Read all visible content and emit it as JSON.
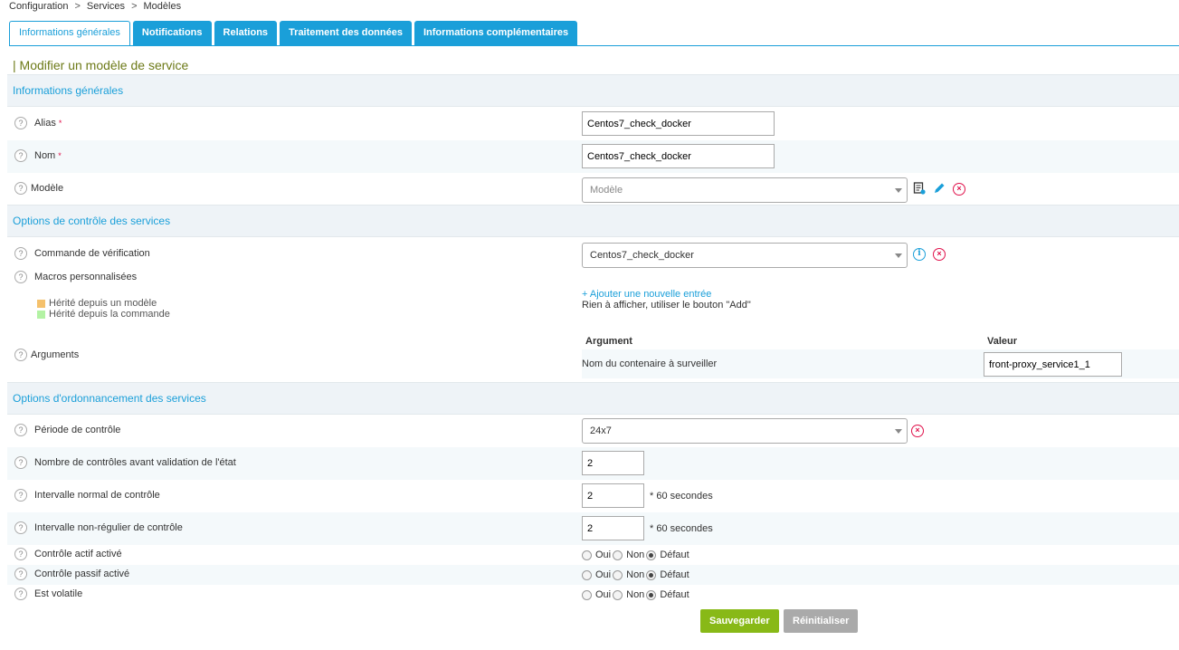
{
  "breadcrumb": [
    "Configuration",
    "Services",
    "Modèles"
  ],
  "tabs": [
    "Informations générales",
    "Notifications",
    "Relations",
    "Traitement des données",
    "Informations complémentaires"
  ],
  "page_title": "| Modifier un modèle de service",
  "sections": {
    "general": "Informations générales",
    "control": "Options de contrôle des services",
    "scheduling": "Options d'ordonnancement des services"
  },
  "fields": {
    "alias": {
      "label": "Alias",
      "value": "Centos7_check_docker",
      "required": "*"
    },
    "nom": {
      "label": "Nom",
      "value": "Centos7_check_docker",
      "required": "*"
    },
    "modele": {
      "label": "Modèle",
      "placeholder": "Modèle"
    },
    "commande": {
      "label": "Commande de vérification",
      "value": "Centos7_check_docker"
    },
    "macros": {
      "label": "Macros personnalisées",
      "add_link": "+ Ajouter une nouvelle entrée",
      "empty": "Rien à afficher, utiliser le bouton \"Add\""
    },
    "legend": {
      "model": "Hérité depuis un modèle",
      "command": "Hérité depuis la commande",
      "model_color": "#f5c16c",
      "command_color": "#b3f2a4"
    },
    "arguments": {
      "label": "Arguments",
      "col_argument": "Argument",
      "col_valeur": "Valeur",
      "arg_name": "Nom du contenaire à surveiller",
      "arg_value": "front-proxy_service1_1"
    },
    "periode": {
      "label": "Période de contrôle",
      "value": "24x7"
    },
    "nb_controles": {
      "label": "Nombre de contrôles avant validation de l'état",
      "value": "2"
    },
    "intervalle_normal": {
      "label": "Intervalle normal de contrôle",
      "value": "2",
      "unit": "* 60 secondes"
    },
    "intervalle_nonreg": {
      "label": "Intervalle non-régulier de contrôle",
      "value": "2",
      "unit": "* 60 secondes"
    },
    "actif": {
      "label": "Contrôle actif activé"
    },
    "passif": {
      "label": "Contrôle passif activé"
    },
    "volatile": {
      "label": "Est volatile"
    }
  },
  "radio_options": {
    "oui": "Oui",
    "non": "Non",
    "defaut": "Défaut"
  },
  "buttons": {
    "save": "Sauvegarder",
    "reset": "Réinitialiser"
  },
  "colors": {
    "accent": "#1a9fd9",
    "title": "#6d7a18",
    "save": "#88b917",
    "danger": "#e0114b"
  }
}
